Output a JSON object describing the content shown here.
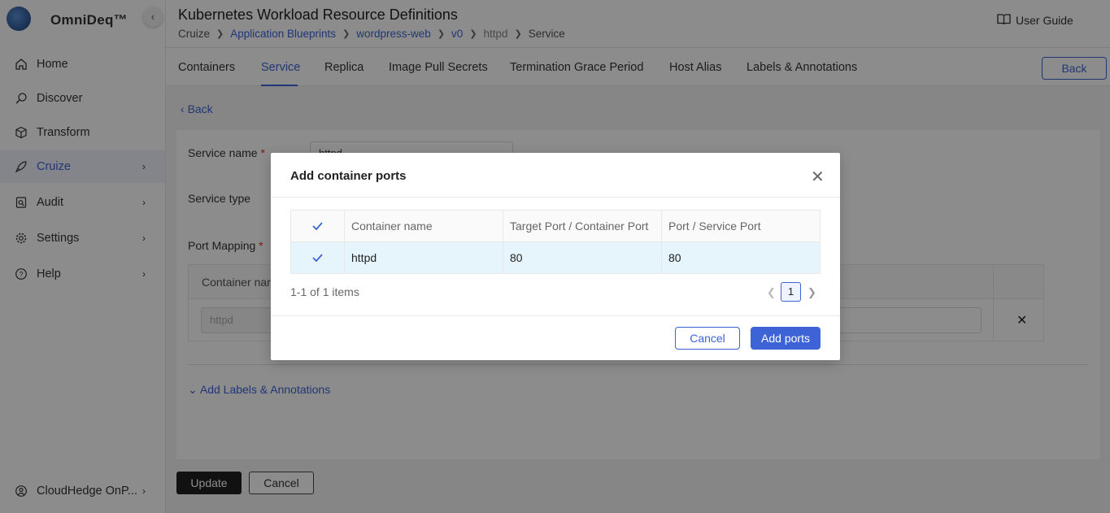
{
  "app": {
    "brand": "OmniDeq™",
    "collapse_icon": "‹"
  },
  "sidebar": {
    "items": [
      {
        "label": "Home",
        "icon": "home-icon",
        "chevron": ""
      },
      {
        "label": "Discover",
        "icon": "discover-icon",
        "chevron": ""
      },
      {
        "label": "Transform",
        "icon": "cube-icon",
        "chevron": ""
      },
      {
        "label": "Cruize",
        "icon": "rocket-icon",
        "chevron": "›"
      },
      {
        "label": "Audit",
        "icon": "audit-icon",
        "chevron": "›"
      },
      {
        "label": "Settings",
        "icon": "gear-icon",
        "chevron": "›"
      },
      {
        "label": "Help",
        "icon": "help-icon",
        "chevron": "›"
      }
    ],
    "user": {
      "label": "CloudHedge OnP...",
      "chevron": "›"
    }
  },
  "header": {
    "title": "Kubernetes Workload Resource Definitions",
    "breadcrumb": [
      "Cruize",
      "Application Blueprints",
      "wordpress-web",
      "v0",
      "httpd",
      "Service"
    ],
    "user_guide": "User Guide"
  },
  "tabs": [
    "Containers",
    "Service",
    "Replica",
    "Image Pull Secrets",
    "Termination Grace Period",
    "Host Alias",
    "Labels & Annotations"
  ],
  "back_button": "Back",
  "main": {
    "back_link": "Back",
    "service_name_label": "Service name",
    "service_name_value": "httpd",
    "service_type_label": "Service type",
    "port_mapping_label": "Port Mapping",
    "port_table_header": "Container nar",
    "port_row_name": "httpd",
    "delete_glyph": "✕",
    "add_labels": "Add Labels & Annotations",
    "update_button": "Update",
    "cancel_button": "Cancel",
    "required_mark": "*"
  },
  "modal": {
    "title": "Add container ports",
    "close_glyph": "✕",
    "columns": [
      "Container name",
      "Target Port / Container Port",
      "Port / Service Port"
    ],
    "rows": [
      {
        "container": "httpd",
        "target_port": "80",
        "service_port": "80"
      }
    ],
    "pager_text": "1-1 of 1 items",
    "page": "1",
    "cancel": "Cancel",
    "add": "Add ports"
  }
}
